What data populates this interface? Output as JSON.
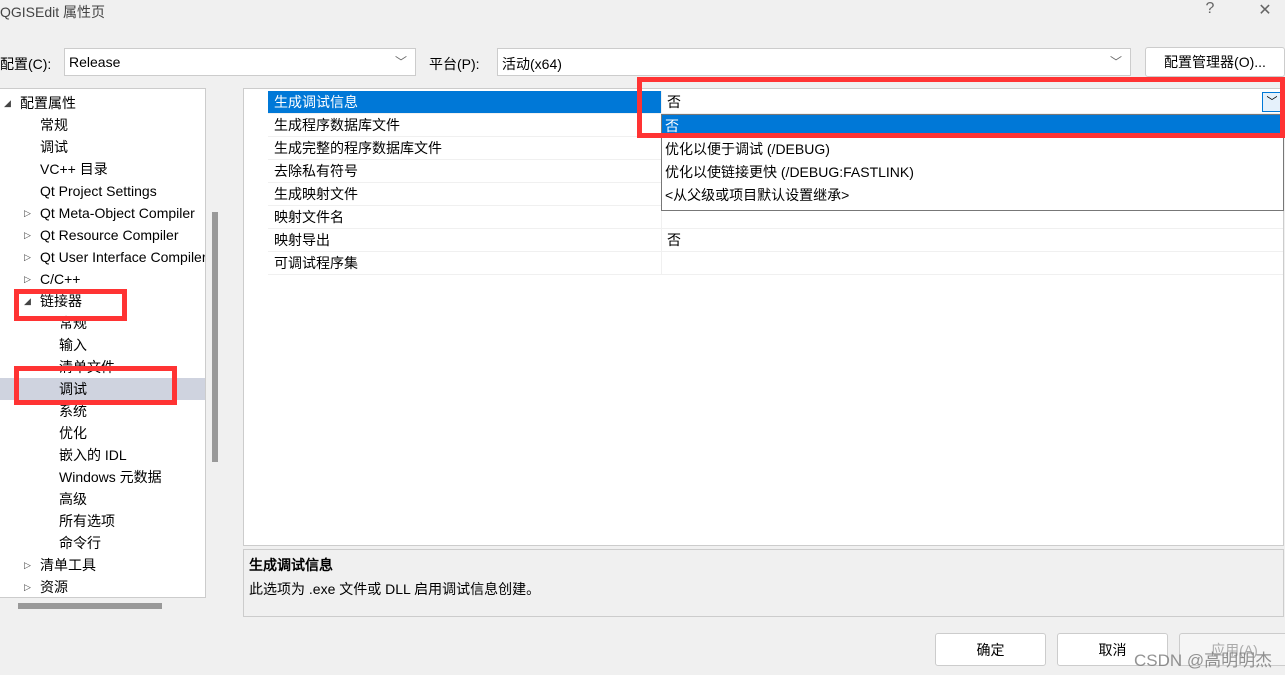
{
  "window": {
    "title": "QGISEdit 属性页",
    "help": "?",
    "close": "✕"
  },
  "config": {
    "label": "配置(C):",
    "value": "Release",
    "platform_label": "平台(P):",
    "platform_value": "活动(x64)",
    "manager_button": "配置管理器(O)..."
  },
  "tree": [
    {
      "label": "配置属性",
      "level": 0,
      "expander": "expanded"
    },
    {
      "label": "常规",
      "level": 1
    },
    {
      "label": "调试",
      "level": 1
    },
    {
      "label": "VC++ 目录",
      "level": 1
    },
    {
      "label": "Qt Project Settings",
      "level": 1
    },
    {
      "label": "Qt Meta-Object Compiler",
      "level": 1,
      "expander": "collapsed"
    },
    {
      "label": "Qt Resource Compiler",
      "level": 1,
      "expander": "collapsed"
    },
    {
      "label": "Qt User Interface Compiler",
      "level": 1,
      "expander": "collapsed"
    },
    {
      "label": "C/C++",
      "level": 1,
      "expander": "collapsed"
    },
    {
      "label": "链接器",
      "level": 1,
      "expander": "expanded"
    },
    {
      "label": "常规",
      "level": 2
    },
    {
      "label": "输入",
      "level": 2
    },
    {
      "label": "清单文件",
      "level": 2
    },
    {
      "label": "调试",
      "level": 2,
      "selected": true
    },
    {
      "label": "系统",
      "level": 2
    },
    {
      "label": "优化",
      "level": 2
    },
    {
      "label": "嵌入的 IDL",
      "level": 2
    },
    {
      "label": "Windows 元数据",
      "level": 2
    },
    {
      "label": "高级",
      "level": 2
    },
    {
      "label": "所有选项",
      "level": 2
    },
    {
      "label": "命令行",
      "level": 2
    },
    {
      "label": "清单工具",
      "level": 1,
      "expander": "collapsed"
    },
    {
      "label": "资源",
      "level": 1,
      "expander": "collapsed"
    }
  ],
  "grid": [
    {
      "name": "生成调试信息",
      "value": "否",
      "selected": true
    },
    {
      "name": "生成程序数据库文件",
      "value": ""
    },
    {
      "name": "生成完整的程序数据库文件",
      "value": ""
    },
    {
      "name": "去除私有符号",
      "value": ""
    },
    {
      "name": "生成映射文件",
      "value": ""
    },
    {
      "name": "映射文件名",
      "value": ""
    },
    {
      "name": "映射导出",
      "value": "否"
    },
    {
      "name": "可调试程序集",
      "value": ""
    }
  ],
  "dropdown": {
    "options": [
      "否",
      "优化以便于调试 (/DEBUG)",
      "优化以使链接更快 (/DEBUG:FASTLINK)",
      "<从父级或项目默认设置继承>"
    ],
    "selected": 0
  },
  "description": {
    "title": "生成调试信息",
    "text": "此选项为 .exe 文件或 DLL 启用调试信息创建。"
  },
  "buttons": {
    "ok": "确定",
    "cancel": "取消",
    "apply": "应用(A)"
  },
  "watermark": "CSDN @高明明杰",
  "colors": {
    "accent": "#0078d7",
    "highlight": "#ff3333"
  }
}
